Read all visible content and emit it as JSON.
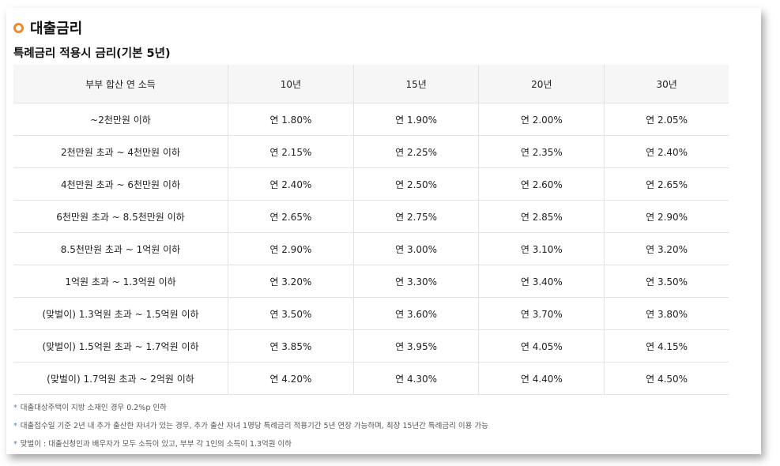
{
  "section": {
    "title": "대출금리",
    "subtitle": "특례금리 적용시 금리(기본 5년)"
  },
  "table": {
    "headers": [
      "부부 합산 연 소득",
      "10년",
      "15년",
      "20년",
      "30년"
    ],
    "rows": [
      [
        "~2천만원 이하",
        "연 1.80%",
        "연 1.90%",
        "연 2.00%",
        "연 2.05%"
      ],
      [
        "2천만원 초과 ~ 4천만원 이하",
        "연 2.15%",
        "연 2.25%",
        "연 2.35%",
        "연 2.40%"
      ],
      [
        "4천만원 초과 ~ 6천만원 이하",
        "연 2.40%",
        "연 2.50%",
        "연 2.60%",
        "연 2.65%"
      ],
      [
        "6천만원 초과 ~ 8.5천만원 이하",
        "연 2.65%",
        "연 2.75%",
        "연 2.85%",
        "연 2.90%"
      ],
      [
        "8.5천만원 초과 ~ 1억원 이하",
        "연 2.90%",
        "연 3.00%",
        "연 3.10%",
        "연 3.20%"
      ],
      [
        "1억원 초과 ~ 1.3억원 이하",
        "연 3.20%",
        "연 3.30%",
        "연 3.40%",
        "연 3.50%"
      ],
      [
        "(맞벌이) 1.3억원 초과 ~ 1.5억원 이하",
        "연 3.50%",
        "연 3.60%",
        "연 3.70%",
        "연 3.80%"
      ],
      [
        "(맞벌이) 1.5억원 초과 ~ 1.7억원 이하",
        "연 3.85%",
        "연 3.95%",
        "연 4.05%",
        "연 4.15%"
      ],
      [
        "(맞벌이) 1.7억원 초과 ~ 2억원 이하",
        "연 4.20%",
        "연 4.30%",
        "연 4.40%",
        "연 4.50%"
      ]
    ]
  },
  "notes": [
    "대출대상주택이 지방 소재인 경우 0.2%p 인하",
    "대출접수일 기준 2년 내 추가 출산한 자녀가 있는 경우, 추가 출산 자녀 1명당 특례금리 적용기간 5년 연장 가능하며, 최장 15년간 특례금리 이용 가능",
    "맞벌이 : 대출신청인과 배우자가 모두 소득이 있고, 부부 각 1인의 소득이 1.3억원 이하"
  ],
  "note_marker": "*",
  "colors": {
    "accent_orange": "#f08a24",
    "note_marker_blue": "#3b7fd4",
    "header_bg": "#f6f6f6"
  }
}
